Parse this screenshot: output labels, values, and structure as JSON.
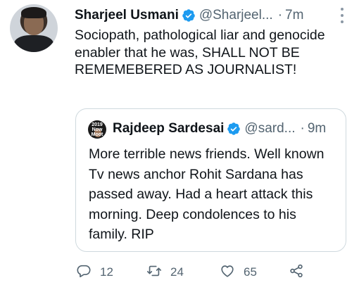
{
  "tweet": {
    "author_name": "Sharjeel Usmani",
    "handle": "@Sharjeel...",
    "separator": "·",
    "time": "7m",
    "text": "Sociopath, pathological liar and genocide enabler that he was, SHALL NOT BE REMEMEBERED AS JOURNALIST!",
    "verified_icon": "verified-badge-icon",
    "more_icon": "more-options-icon"
  },
  "quoted_tweet": {
    "avatar_text": "2019 Now Moot",
    "author_name": "Rajdeep Sardesai",
    "handle": "@sard...",
    "separator": "·",
    "time": "9m",
    "text": "More terrible news friends. Well known Tv news anchor Rohit Sardana has passed away. Had a heart attack this morning. Deep condolences to his family. RIP"
  },
  "actions": {
    "reply_count": "12",
    "retweet_count": "24",
    "like_count": "65"
  },
  "colors": {
    "text_primary": "#0f1419",
    "text_secondary": "#536471",
    "verified": "#1d9bf0",
    "border": "#cfd9de"
  }
}
